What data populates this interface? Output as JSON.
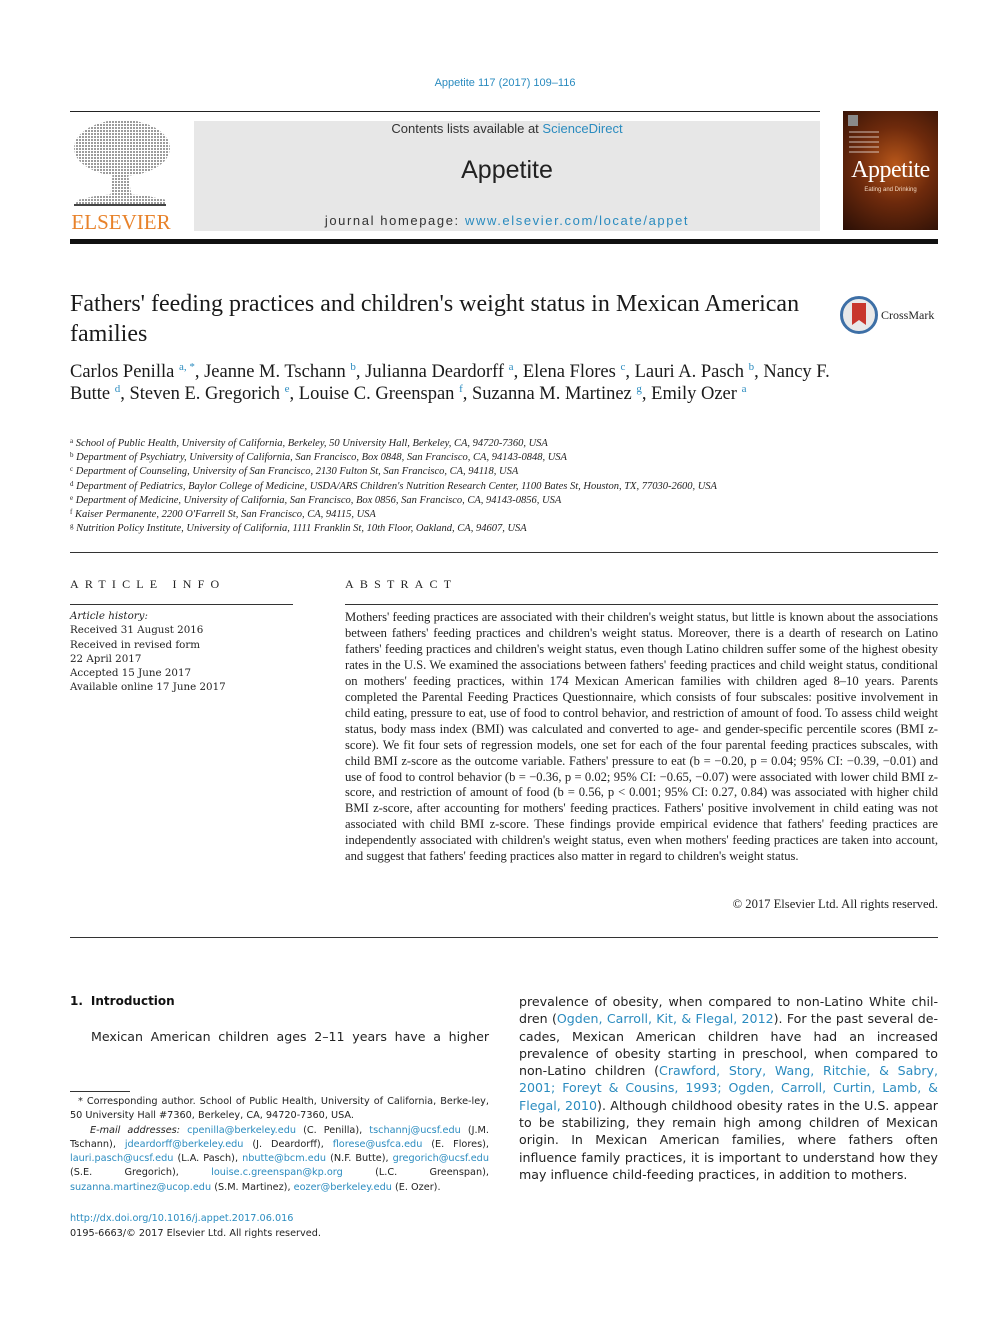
{
  "header": {
    "citation": "Appetite 117 (2017) 109–116",
    "contents_prefix": "Contents lists available at ",
    "contents_link": "ScienceDirect",
    "journal_name": "Appetite",
    "homepage_prefix": "journal homepage: ",
    "homepage_link": "www.elsevier.com/locate/appet",
    "publisher_logo_text": "ELSEVIER",
    "cover_title": "Appetite",
    "cover_subtitle": "Eating and Drinking",
    "crossmark_label": "CrossMark",
    "colors": {
      "link": "#2a8bbf",
      "elsevier_orange": "#e8822a",
      "header_box": "#e7e7e7"
    }
  },
  "article": {
    "title": "Fathers' feeding practices and children's weight status in Mexican American families",
    "authors": [
      {
        "name": "Carlos Penilla",
        "sup": "a, *",
        "sep": ", "
      },
      {
        "name": "Jeanne M. Tschann",
        "sup": "b",
        "sep": ", "
      },
      {
        "name": "Julianna Deardorff",
        "sup": "a",
        "sep": ", "
      },
      {
        "name": "Elena Flores",
        "sup": "c",
        "sep": ", "
      },
      {
        "name": "Lauri A. Pasch",
        "sup": "b",
        "sep": ", "
      },
      {
        "name": "Nancy F. Butte",
        "sup": "d",
        "sep": ", "
      },
      {
        "name": "Steven E. Gregorich",
        "sup": "e",
        "sep": ", "
      },
      {
        "name": "Louise C. Greenspan",
        "sup": "f",
        "sep": ", "
      },
      {
        "name": "Suzanna M. Martinez",
        "sup": "g",
        "sep": ", "
      },
      {
        "name": "Emily Ozer",
        "sup": "a",
        "sep": ""
      }
    ],
    "affiliations": [
      {
        "key": "a",
        "text": "School of Public Health, University of California, Berkeley, 50 University Hall, Berkeley, CA, 94720-7360, USA"
      },
      {
        "key": "b",
        "text": "Department of Psychiatry, University of California, San Francisco, Box 0848, San Francisco, CA, 94143-0848, USA"
      },
      {
        "key": "c",
        "text": "Department of Counseling, University of San Francisco, 2130 Fulton St, San Francisco, CA, 94118, USA"
      },
      {
        "key": "d",
        "text": "Department of Pediatrics, Baylor College of Medicine, USDA/ARS Children's Nutrition Research Center, 1100 Bates St, Houston, TX, 77030-2600, USA"
      },
      {
        "key": "e",
        "text": "Department of Medicine, University of California, San Francisco, Box 0856, San Francisco, CA, 94143-0856, USA"
      },
      {
        "key": "f",
        "text": "Kaiser Permanente, 2200 O'Farrell St, San Francisco, CA, 94115, USA"
      },
      {
        "key": "g",
        "text": "Nutrition Policy Institute, University of California, 1111 Franklin St, 10th Floor, Oakland, CA, 94607, USA"
      }
    ]
  },
  "article_info": {
    "heading": "ARTICLE INFO",
    "history_label": "Article history:",
    "history": [
      "Received 31 August 2016",
      "Received in revised form",
      "22 April 2017",
      "Accepted 15 June 2017",
      "Available online 17 June 2017"
    ]
  },
  "abstract": {
    "heading": "ABSTRACT",
    "text": "Mothers' feeding practices are associated with their children's weight status, but little is known about the associations between fathers' feeding practices and children's weight status. Moreover, there is a dearth of research on Latino fathers' feeding practices and children's weight status, even though Latino children suffer some of the highest obesity rates in the U.S. We examined the associations between fathers' feeding practices and child weight status, conditional on mothers' feeding practices, within 174 Mexican American families with children aged 8–10 years. Parents completed the Parental Feeding Practices Questionnaire, which consists of four subscales: positive involvement in child eating, pressure to eat, use of food to control behavior, and restriction of amount of food. To assess child weight status, body mass index (BMI) was calculated and converted to age- and gender-specific percentile scores (BMI z-score). We fit four sets of regression models, one set for each of the four parental feeding practices subscales, with child BMI z-score as the outcome variable. Fathers' pressure to eat (b = −0.20, p = 0.04; 95% CI: −0.39, −0.01) and use of food to control behavior (b = −0.36, p = 0.02; 95% CI: −0.65, −0.07) were associated with lower child BMI z-score, and restriction of amount of food (b = 0.56, p < 0.001; 95% CI: 0.27, 0.84) was associated with higher child BMI z-score, after accounting for mothers' feeding practices. Fathers' positive involvement in child eating was not associated with child BMI z-score. These findings provide empirical evidence that fathers' feeding practices are independently associated with children's weight status, even when mothers' feeding practices are taken into account, and suggest that fathers' feeding practices also matter in regard to children's weight status.",
    "copyright": "© 2017 Elsevier Ltd. All rights reserved."
  },
  "introduction": {
    "number": "1.",
    "heading": "Introduction",
    "left_text": "Mexican American children ages 2–11 years have a higher",
    "right_segments": [
      {
        "t": "prevalence of obesity, when compared to non-Latino White chil-dren (",
        "link": false
      },
      {
        "t": "Ogden, Carroll, Kit, & Flegal, 2012",
        "link": true
      },
      {
        "t": "). For the past several de-cades, Mexican American children have had an increased prevalence of obesity starting in preschool, when compared to non-Latino children (",
        "link": false
      },
      {
        "t": "Crawford, Story, Wang, Ritchie, & Sabry, 2001; Foreyt & Cousins, 1993; Ogden, Carroll, Curtin, Lamb, & Flegal, 2010",
        "link": true
      },
      {
        "t": "). Although childhood obesity rates in the U.S. appear to be stabilizing, they remain high among children of Mexican origin. In Mexican American families, where fathers often influence family practices, it is important to understand how they may influence child-feeding practices, in addition to mothers.",
        "link": false
      }
    ]
  },
  "footnotes": {
    "corresponding": "* Corresponding author. School of Public Health, University of California, Berke-ley, 50 University Hall #7360, Berkeley, CA, 94720-7360, USA.",
    "email_label": "E-mail addresses:",
    "emails": [
      {
        "email": "cpenilla@berkeley.edu",
        "who": "(C. Penilla)"
      },
      {
        "email": "tschannj@ucsf.edu",
        "who": "(J.M. Tschann)"
      },
      {
        "email": "jdeardorff@berkeley.edu",
        "who": "(J. Deardorff)"
      },
      {
        "email": "florese@usfca.edu",
        "who": "(E. Flores)"
      },
      {
        "email": "lauri.pasch@ucsf.edu",
        "who": "(L.A. Pasch)"
      },
      {
        "email": "nbutte@bcm.edu",
        "who": "(N.F. Butte)"
      },
      {
        "email": "gregorich@ucsf.edu",
        "who": "(S.E. Gregorich)"
      },
      {
        "email": "louise.c.greenspan@kp.org",
        "who": "(L.C. Greenspan)"
      },
      {
        "email": "suzanna.martinez@ucop.edu",
        "who": "(S.M. Martinez)"
      },
      {
        "email": "eozer@berkeley.edu",
        "who": "(E. Ozer)."
      }
    ],
    "doi": "http://dx.doi.org/10.1016/j.appet.2017.06.016",
    "issn_copyright": "0195-6663/© 2017 Elsevier Ltd. All rights reserved."
  }
}
